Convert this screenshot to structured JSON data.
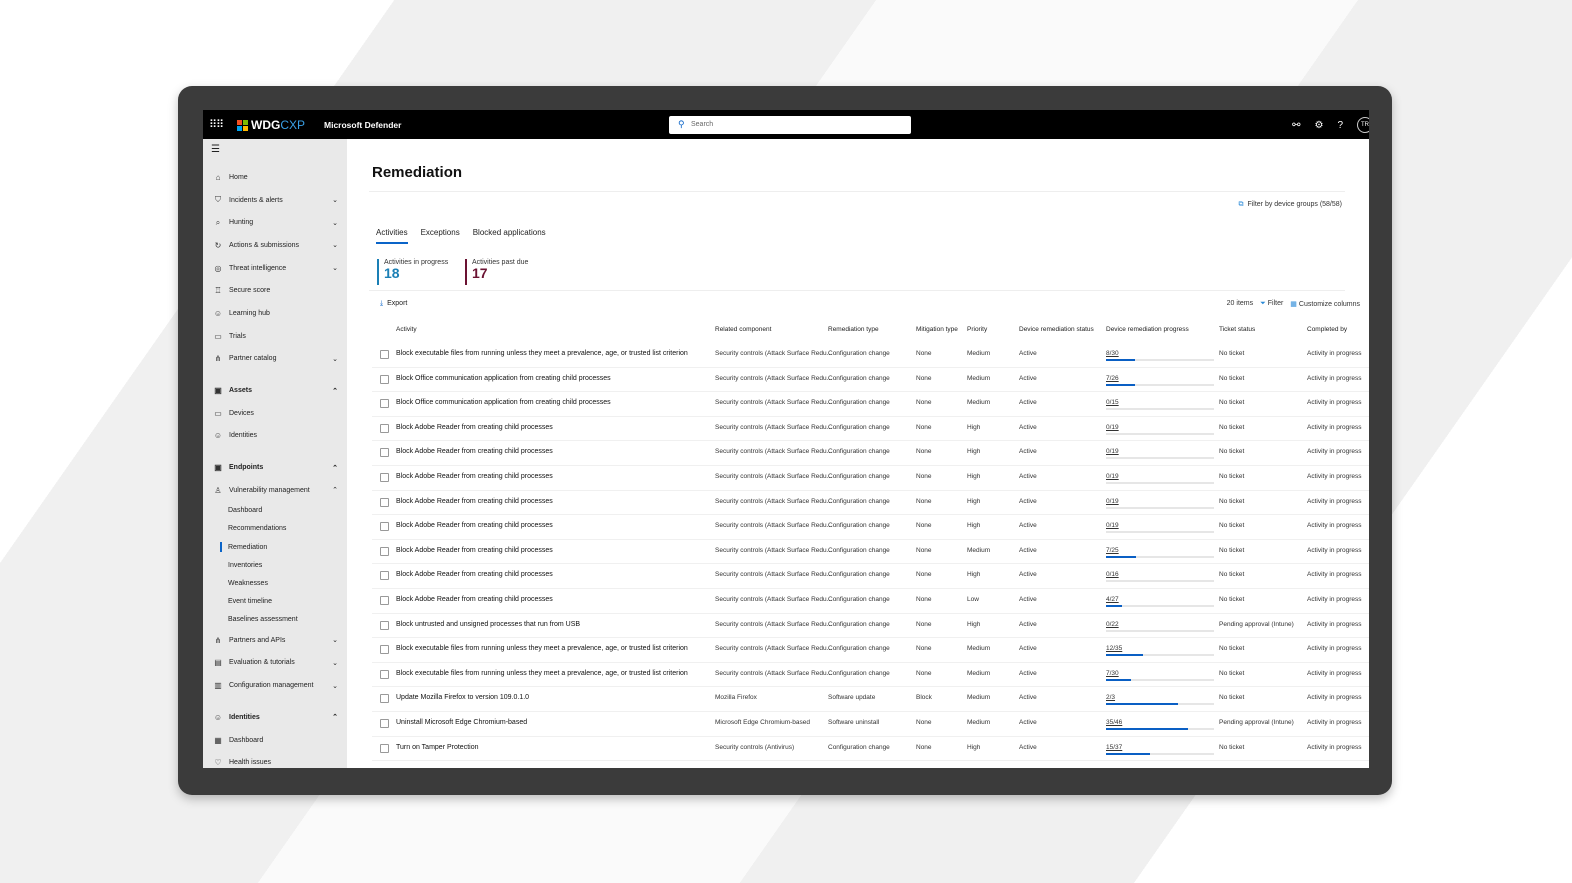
{
  "topbar": {
    "brand_a": "WDG",
    "brand_b": "CXP",
    "app": "Microsoft Defender",
    "search_placeholder": "Search",
    "avatar": "TR"
  },
  "sidebar": {
    "items": [
      {
        "label": "Home",
        "icon": "⌂",
        "type": "item"
      },
      {
        "label": "Incidents & alerts",
        "icon": "⛉",
        "type": "item",
        "chev": "⌄"
      },
      {
        "label": "Hunting",
        "icon": "⌕",
        "type": "item",
        "chev": "⌄"
      },
      {
        "label": "Actions & submissions",
        "icon": "↻",
        "type": "item",
        "chev": "⌄"
      },
      {
        "label": "Threat intelligence",
        "icon": "◎",
        "type": "item",
        "chev": "⌄"
      },
      {
        "label": "Secure score",
        "icon": "♖",
        "type": "item"
      },
      {
        "label": "Learning hub",
        "icon": "☺",
        "type": "item"
      },
      {
        "label": "Trials",
        "icon": "▭",
        "type": "item"
      },
      {
        "label": "Partner catalog",
        "icon": "⋔",
        "type": "item",
        "chev": "⌄"
      },
      {
        "label": "Assets",
        "icon": "▣",
        "type": "section",
        "chev": "⌃"
      },
      {
        "label": "Devices",
        "icon": "▭",
        "type": "item"
      },
      {
        "label": "Identities",
        "icon": "☺",
        "type": "item"
      },
      {
        "label": "Endpoints",
        "icon": "▣",
        "type": "section",
        "chev": "⌃"
      },
      {
        "label": "Vulnerability management",
        "icon": "♙",
        "type": "item",
        "chev": "⌃"
      },
      {
        "label": "Dashboard",
        "type": "sub"
      },
      {
        "label": "Recommendations",
        "type": "sub"
      },
      {
        "label": "Remediation",
        "type": "sub",
        "active": true
      },
      {
        "label": "Inventories",
        "type": "sub"
      },
      {
        "label": "Weaknesses",
        "type": "sub"
      },
      {
        "label": "Event timeline",
        "type": "sub"
      },
      {
        "label": "Baselines assessment",
        "type": "sub"
      },
      {
        "label": "Partners and APIs",
        "icon": "⋔",
        "type": "item",
        "chev": "⌄"
      },
      {
        "label": "Evaluation & tutorials",
        "icon": "▤",
        "type": "item",
        "chev": "⌄"
      },
      {
        "label": "Configuration management",
        "icon": "▥",
        "type": "item",
        "chev": "⌄"
      },
      {
        "label": "Identities",
        "icon": "☺",
        "type": "section",
        "chev": "⌃"
      },
      {
        "label": "Dashboard",
        "icon": "▦",
        "type": "item"
      },
      {
        "label": "Health issues",
        "icon": "♡",
        "type": "item"
      }
    ]
  },
  "page": {
    "title": "Remediation",
    "filter_groups": "Filter by device groups (58/58)",
    "tabs": [
      "Activities",
      "Exceptions",
      "Blocked applications"
    ],
    "kpi_progress": {
      "label": "Activities in progress",
      "value": "18",
      "color": "#1a7fb5"
    },
    "kpi_pastdue": {
      "label": "Activities past due",
      "value": "17",
      "color": "#6b1232"
    },
    "export": "Export",
    "items": "20 items",
    "filter": "Filter",
    "customize": "Customize columns"
  },
  "table": {
    "columns": [
      "Activity",
      "Related component",
      "Remediation type",
      "Mitigation type",
      "Priority",
      "Device remediation status",
      "Device remediation progress",
      "Ticket status",
      "Completed by"
    ],
    "rows": [
      [
        "Block executable files from running unless they meet a prevalence, age, or trusted list criterion",
        "Security controls (Attack Surface Redu...",
        "Configuration change",
        "None",
        "Medium",
        "Active",
        "8/30",
        "No ticket",
        "Activity in progress"
      ],
      [
        "Block Office communication application from creating child processes",
        "Security controls (Attack Surface Redu...",
        "Configuration change",
        "None",
        "Medium",
        "Active",
        "7/26",
        "No ticket",
        "Activity in progress"
      ],
      [
        "Block Office communication application from creating child processes",
        "Security controls (Attack Surface Redu...",
        "Configuration change",
        "None",
        "Medium",
        "Active",
        "0/15",
        "No ticket",
        "Activity in progress"
      ],
      [
        "Block Adobe Reader from creating child processes",
        "Security controls (Attack Surface Redu...",
        "Configuration change",
        "None",
        "High",
        "Active",
        "0/19",
        "No ticket",
        "Activity in progress"
      ],
      [
        "Block Adobe Reader from creating child processes",
        "Security controls (Attack Surface Redu...",
        "Configuration change",
        "None",
        "High",
        "Active",
        "0/19",
        "No ticket",
        "Activity in progress"
      ],
      [
        "Block Adobe Reader from creating child processes",
        "Security controls (Attack Surface Redu...",
        "Configuration change",
        "None",
        "High",
        "Active",
        "0/19",
        "No ticket",
        "Activity in progress"
      ],
      [
        "Block Adobe Reader from creating child processes",
        "Security controls (Attack Surface Redu...",
        "Configuration change",
        "None",
        "High",
        "Active",
        "0/19",
        "No ticket",
        "Activity in progress"
      ],
      [
        "Block Adobe Reader from creating child processes",
        "Security controls (Attack Surface Redu...",
        "Configuration change",
        "None",
        "High",
        "Active",
        "0/19",
        "No ticket",
        "Activity in progress"
      ],
      [
        "Block Adobe Reader from creating child processes",
        "Security controls (Attack Surface Redu...",
        "Configuration change",
        "None",
        "Medium",
        "Active",
        "7/25",
        "No ticket",
        "Activity in progress"
      ],
      [
        "Block Adobe Reader from creating child processes",
        "Security controls (Attack Surface Redu...",
        "Configuration change",
        "None",
        "High",
        "Active",
        "0/16",
        "No ticket",
        "Activity in progress"
      ],
      [
        "Block Adobe Reader from creating child processes",
        "Security controls (Attack Surface Redu...",
        "Configuration change",
        "None",
        "Low",
        "Active",
        "4/27",
        "No ticket",
        "Activity in progress"
      ],
      [
        "Block untrusted and unsigned processes that run from USB",
        "Security controls (Attack Surface Redu...",
        "Configuration change",
        "None",
        "High",
        "Active",
        "0/22",
        "Pending approval (Intune)",
        "Activity in progress"
      ],
      [
        "Block executable files from running unless they meet a prevalence, age, or trusted list criterion",
        "Security controls (Attack Surface Redu...",
        "Configuration change",
        "None",
        "Medium",
        "Active",
        "12/35",
        "No ticket",
        "Activity in progress"
      ],
      [
        "Block executable files from running unless they meet a prevalence, age, or trusted list criterion",
        "Security controls (Attack Surface Redu...",
        "Configuration change",
        "None",
        "Medium",
        "Active",
        "7/30",
        "No ticket",
        "Activity in progress"
      ],
      [
        "Update Mozilla Firefox to version 109.0.1.0",
        "Mozilla Firefox",
        "Software update",
        "Block",
        "Medium",
        "Active",
        "2/3",
        "No ticket",
        "Activity in progress"
      ],
      [
        "Uninstall Microsoft Edge Chromium-based",
        "Microsoft Edge Chromium-based",
        "Software uninstall",
        "None",
        "Medium",
        "Active",
        "35/46",
        "Pending approval (Intune)",
        "Activity in progress"
      ],
      [
        "Turn on Tamper Protection",
        "Security controls (Antivirus)",
        "Configuration change",
        "None",
        "High",
        "Active",
        "15/37",
        "No ticket",
        "Activity in progress"
      ]
    ]
  }
}
